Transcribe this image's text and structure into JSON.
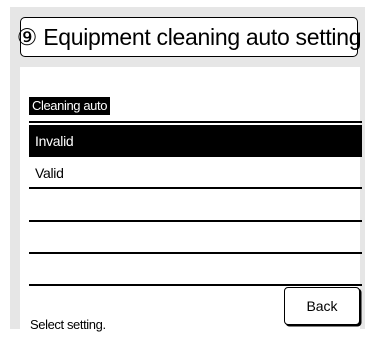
{
  "header": {
    "title": "⑨ Equipment cleaning auto setting"
  },
  "section": {
    "label": "Cleaning auto"
  },
  "options": [
    {
      "label": "Invalid",
      "selected": true
    },
    {
      "label": "Valid",
      "selected": false
    },
    {
      "label": "",
      "selected": false
    },
    {
      "label": "",
      "selected": false
    },
    {
      "label": "",
      "selected": false
    }
  ],
  "footer": {
    "status": "Select setting.",
    "back_label": "Back"
  }
}
